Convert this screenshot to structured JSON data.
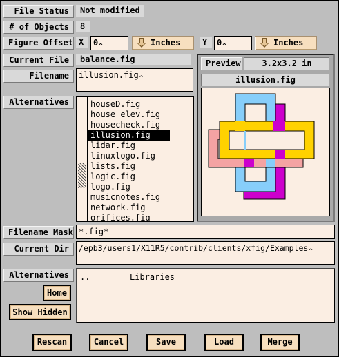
{
  "file_status": {
    "label": "File Status",
    "value": "Not modified"
  },
  "num_objects": {
    "label": "# of Objects",
    "value": "8"
  },
  "figure_offset": {
    "label": "Figure Offset",
    "x_label": "X",
    "x_value": "0",
    "x_units": "Inches",
    "y_label": "Y",
    "y_value": "0",
    "y_units": "Inches"
  },
  "current_file": {
    "label": "Current File",
    "value": "balance.fig"
  },
  "filename": {
    "label": "Filename",
    "value": "illusion.fig"
  },
  "alternatives_files": {
    "label": "Alternatives",
    "items": [
      "houseD.fig",
      "house_elev.fig",
      "housecheck.fig",
      "illusion.fig",
      "lidar.fig",
      "linuxlogo.fig",
      "lists.fig",
      "logic.fig",
      "logo.fig",
      "musicnotes.fig",
      "network.fig",
      "orifices.fig"
    ],
    "selected_index": 3
  },
  "preview": {
    "label": "Preview",
    "size": "3.2x3.2 in",
    "filename": "illusion.fig"
  },
  "filename_mask": {
    "label": "Filename Mask",
    "value": "*.fig*"
  },
  "current_dir": {
    "label": "Current Dir",
    "value": "/epb3/users1/X11R5/contrib/clients/xfig/Examples"
  },
  "alternatives_dirs": {
    "label": "Alternatives",
    "items": [
      ".."
    ],
    "extra_item": "Libraries"
  },
  "side_buttons": {
    "home": "Home",
    "show_hidden": "Show Hidden"
  },
  "buttons": {
    "rescan": "Rescan",
    "cancel": "Cancel",
    "save": "Save",
    "load": "Load",
    "merge": "Merge"
  },
  "colors": {
    "background": "#bebebe",
    "field": "#fbeee3",
    "button": "#f7dfbf",
    "shape_blue": "#87cefa",
    "shape_magenta": "#cc00cc",
    "shape_pink": "#f4a3a3",
    "shape_gold": "#ffd200"
  }
}
